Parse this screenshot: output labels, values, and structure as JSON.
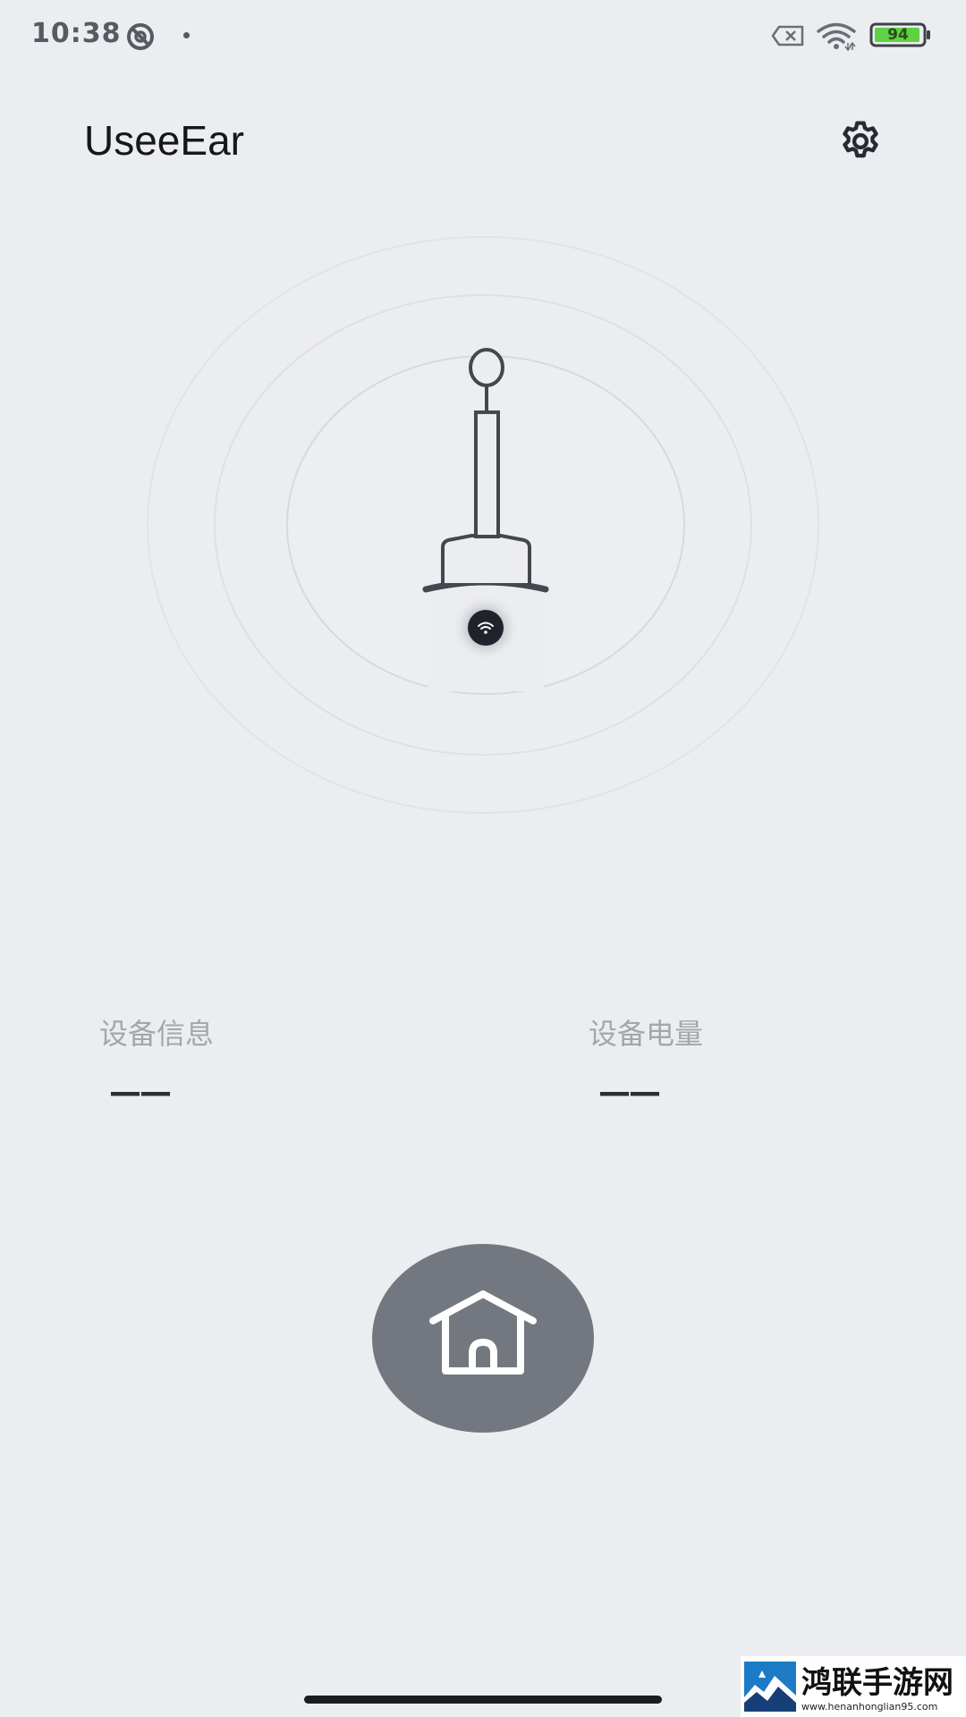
{
  "status_bar": {
    "time": "10:38",
    "battery_level": "94",
    "icons": [
      "do-not-disturb-icon",
      "notification-dot",
      "no-sim-icon",
      "wifi-icon",
      "battery-icon"
    ]
  },
  "header": {
    "title": "UseeEar",
    "settings_icon": "gear-icon"
  },
  "device": {
    "illustration": "ear-camera-device",
    "connection_icon": "wifi-icon",
    "status": "disconnected"
  },
  "info": {
    "device_info_label": "设备信息",
    "device_info_value": "——",
    "battery_label": "设备电量",
    "battery_value": "——"
  },
  "home_button": {
    "icon": "home-icon"
  },
  "watermark": {
    "name": "鸿联手游网",
    "url": "www.henanhonglian95.com"
  },
  "colors": {
    "background": "#ecedf0",
    "home_button": "#737880",
    "battery_fill": "#5fd243",
    "title_text": "#15171b",
    "label_text": "#a3a6ab"
  }
}
